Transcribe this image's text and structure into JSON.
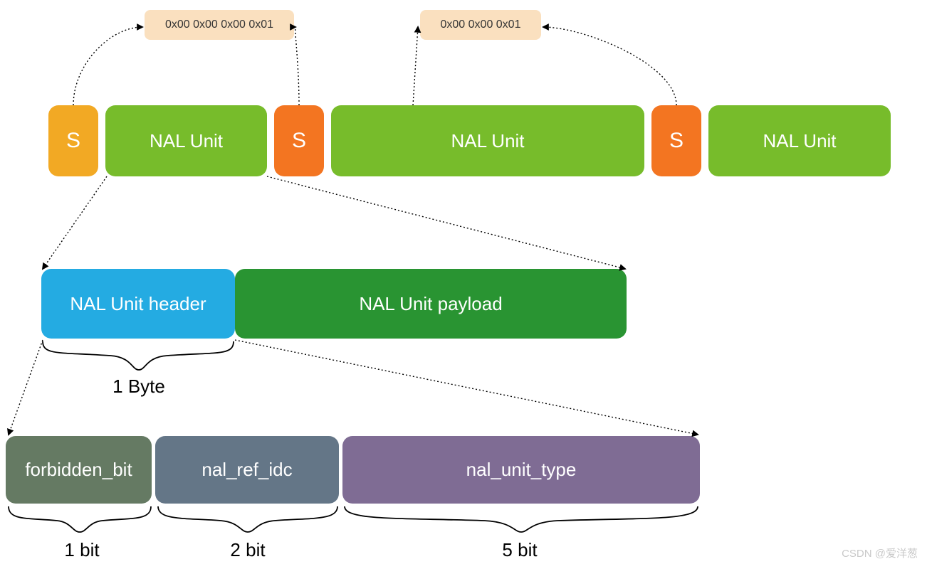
{
  "annotations": {
    "startcode4": "0x00 0x00 0x00 0x01",
    "startcode3": "0x00 0x00 0x01"
  },
  "stream": {
    "s1": "S",
    "u1": "NAL Unit",
    "s2": "S",
    "u2": "NAL Unit",
    "s3": "S",
    "u3": "NAL Unit"
  },
  "unit": {
    "header": "NAL Unit header",
    "payload": "NAL Unit payload",
    "header_size": "1 Byte"
  },
  "header_fields": {
    "f1": "forbidden_bit",
    "b1": "1 bit",
    "f2": "nal_ref_idc",
    "b2": "2 bit",
    "f3": "nal_unit_type",
    "b3": "5 bit"
  },
  "watermark": "CSDN @爱洋葱"
}
